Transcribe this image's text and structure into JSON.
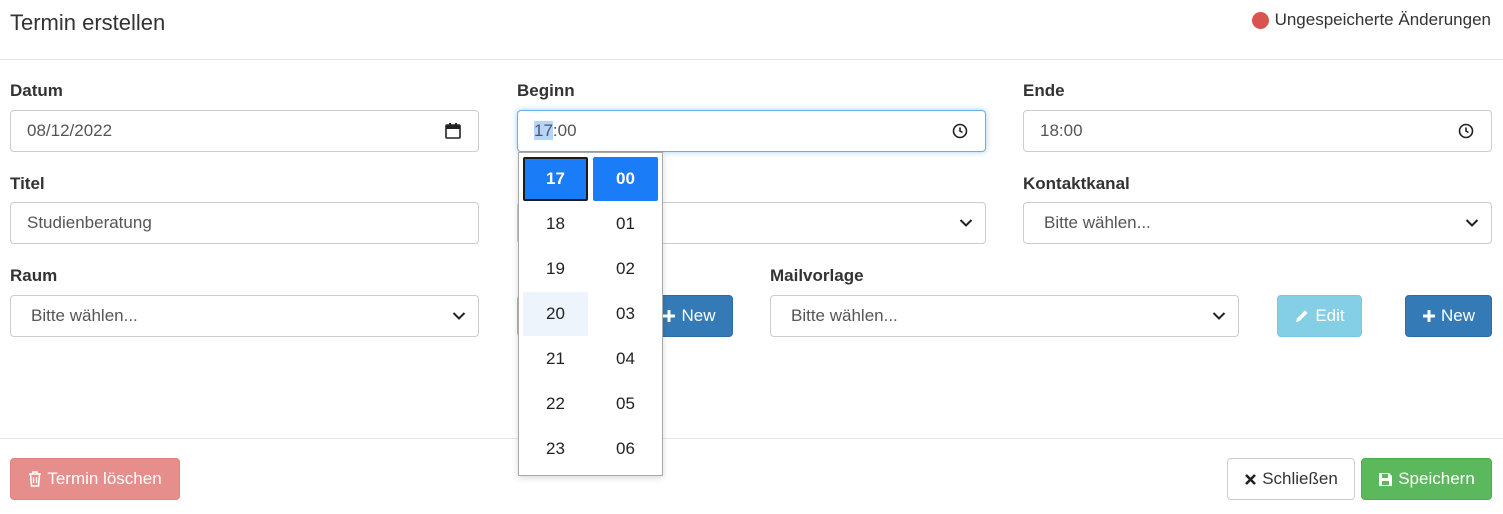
{
  "header": {
    "title": "Termin erstellen",
    "unsaved_label": "Ungespeicherte Änderungen",
    "unsaved_color": "#d9534f"
  },
  "form": {
    "datum": {
      "label": "Datum",
      "value": "08/12/2022",
      "icon": "calendar-icon"
    },
    "beginn": {
      "label": "Beginn",
      "hour": "17",
      "separator": ":",
      "minute": "00",
      "icon": "clock-icon"
    },
    "ende": {
      "label": "Ende",
      "value": "18:00",
      "icon": "clock-icon"
    },
    "titel": {
      "label": "Titel",
      "value": "Studienberatung"
    },
    "kontaktkanal": {
      "label": "Kontaktkanal",
      "value": "Bitte wählen..."
    },
    "raum": {
      "label": "Raum",
      "value": "Bitte wählen..."
    },
    "mailvorlage": {
      "label": "Mailvorlage",
      "value": "Bitte wählen..."
    }
  },
  "buttons": {
    "new_label": "New",
    "edit_label": "Edit",
    "delete_label": "Termin löschen",
    "close_label": "Schließen",
    "save_label": "Speichern"
  },
  "time_picker": {
    "hours": [
      "17",
      "18",
      "19",
      "20",
      "21",
      "22",
      "23"
    ],
    "minutes": [
      "00",
      "01",
      "02",
      "03",
      "04",
      "05",
      "06"
    ],
    "selected_hour": "17",
    "selected_minute": "00",
    "selected_color": "#1a7cf7"
  }
}
